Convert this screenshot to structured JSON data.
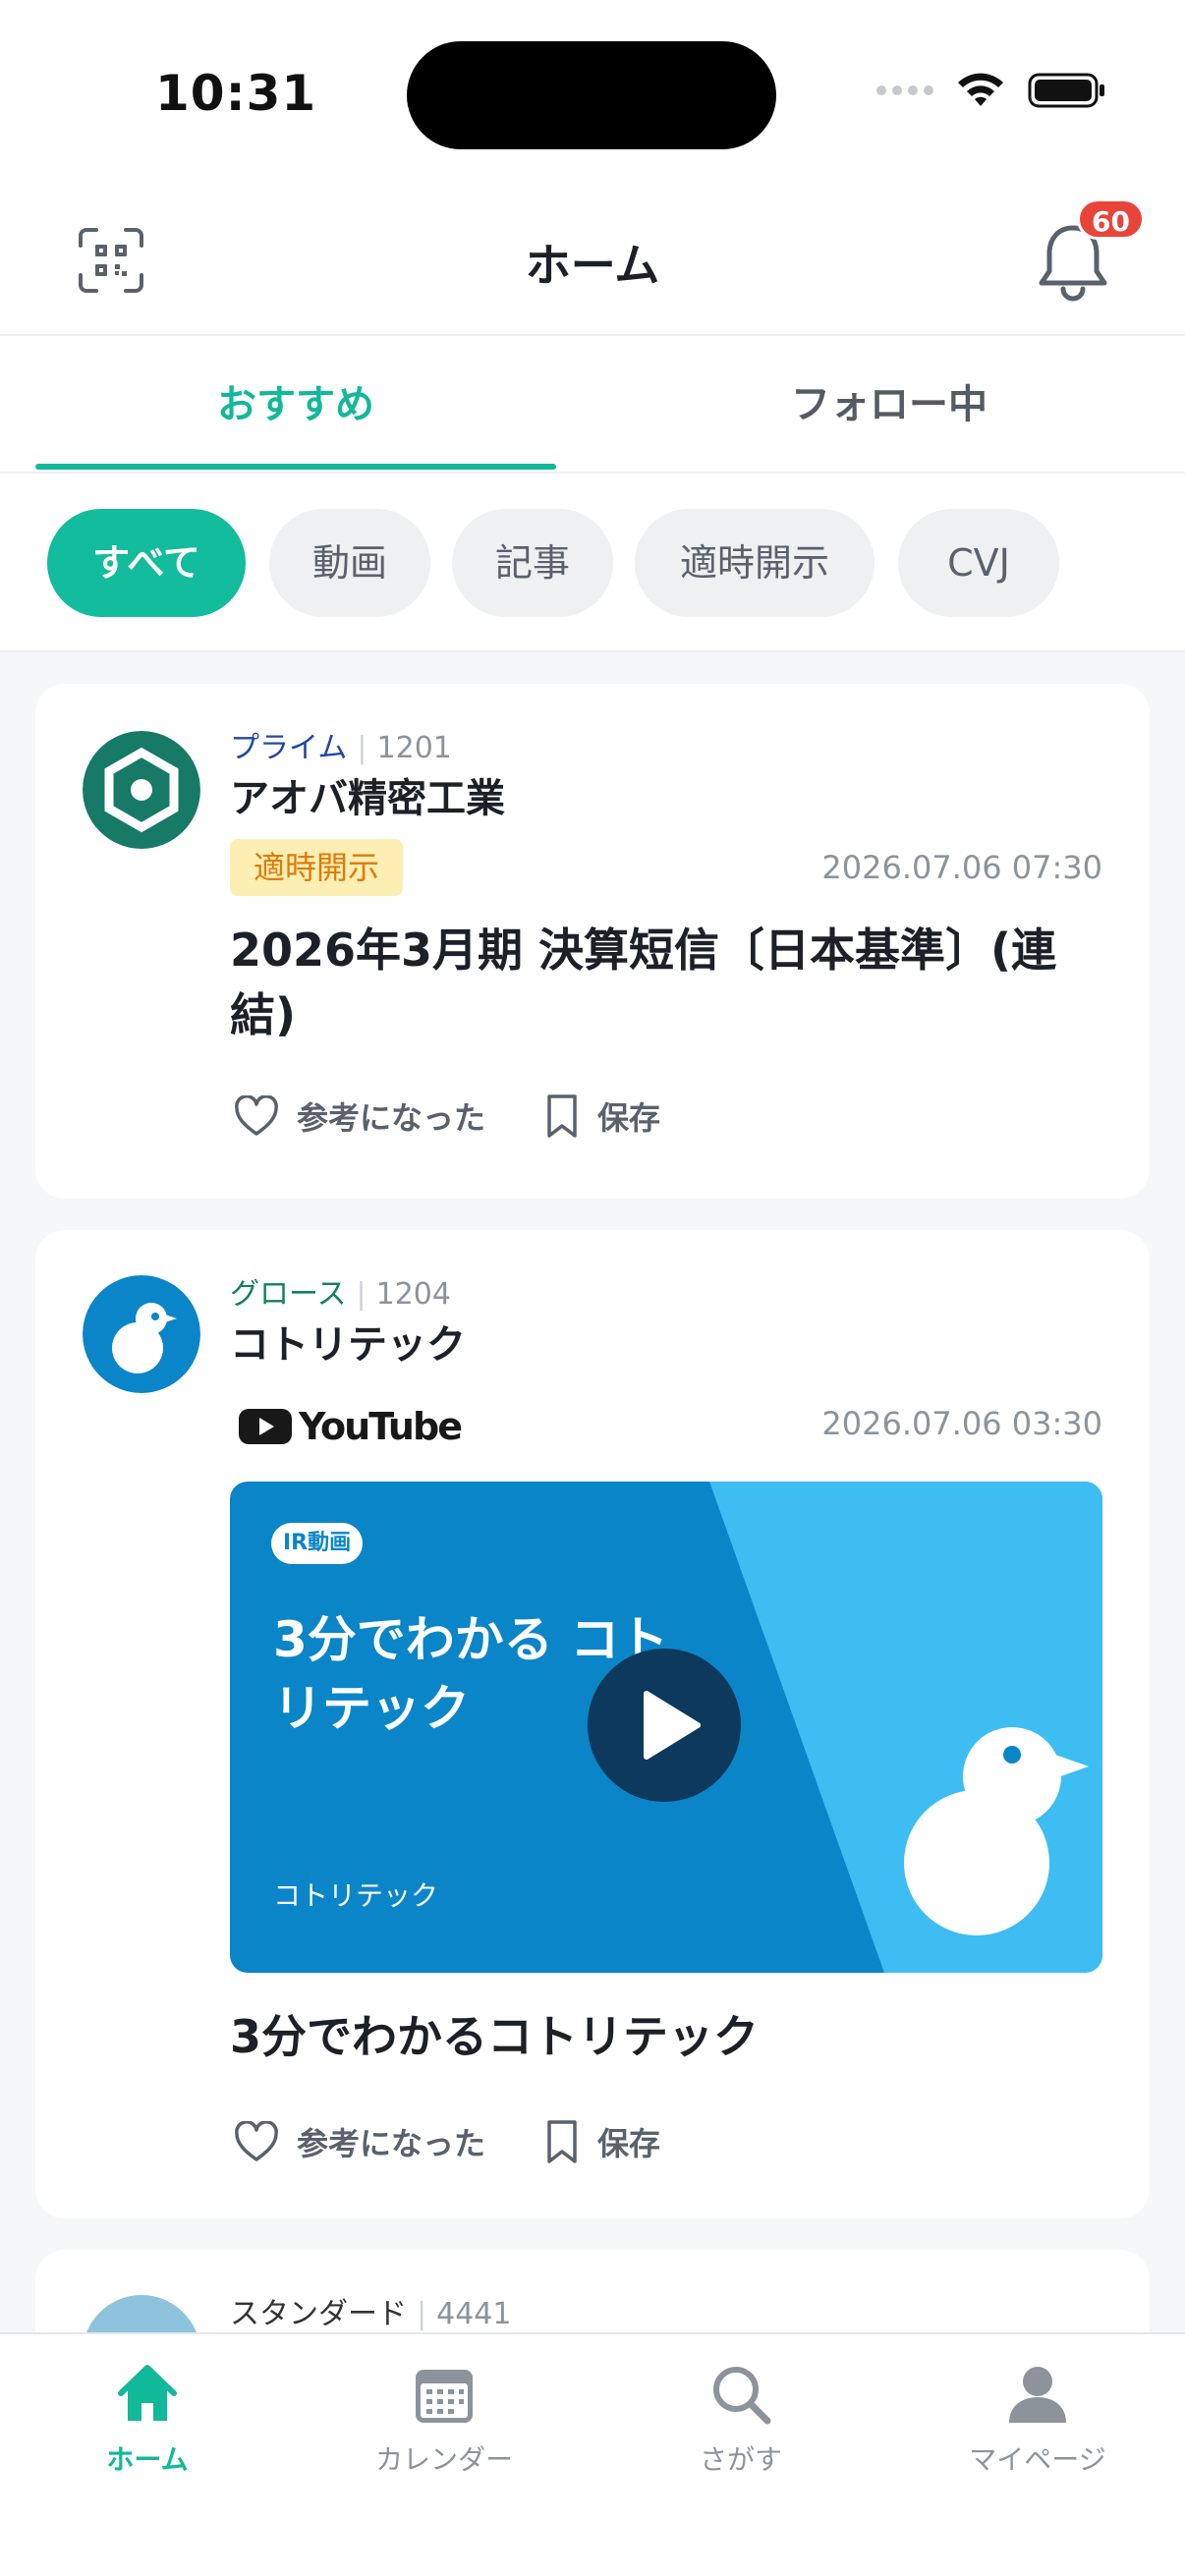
{
  "status_bar": {
    "time": "10:31"
  },
  "header": {
    "title": "ホーム",
    "notification_count": "60"
  },
  "tabs": [
    {
      "label": "おすすめ",
      "active": true
    },
    {
      "label": "フォロー中",
      "active": false
    }
  ],
  "filters": [
    {
      "label": "すべて",
      "active": true
    },
    {
      "label": "動画",
      "active": false
    },
    {
      "label": "記事",
      "active": false
    },
    {
      "label": "適時開示",
      "active": false
    },
    {
      "label": "CVJ",
      "active": false
    }
  ],
  "feed": [
    {
      "market": "プライム",
      "code": "1201",
      "company": "アオバ精密工業",
      "type_tag": "適時開示",
      "date": "2026.07.06 07:30",
      "title": "2026年3月期 決算短信〔日本基準〕(連結)",
      "like_label": "参考になった",
      "save_label": "保存"
    },
    {
      "market": "グロース",
      "code": "1204",
      "company": "コトリテック",
      "source": "YouTube",
      "date": "2026.07.06 03:30",
      "video": {
        "tag": "IR動画",
        "headline": "3分でわかる コトリテック",
        "brand": "コトリテック"
      },
      "title": "3分でわかるコトリテック",
      "like_label": "参考になった",
      "save_label": "保存"
    },
    {
      "market": "スタンダード",
      "code": "4441"
    }
  ],
  "bottom_nav": [
    {
      "label": "ホーム",
      "icon": "home-icon",
      "active": true
    },
    {
      "label": "カレンダー",
      "icon": "calendar-icon",
      "active": false
    },
    {
      "label": "さがす",
      "icon": "search-icon",
      "active": false
    },
    {
      "label": "マイページ",
      "icon": "person-icon",
      "active": false
    }
  ],
  "colors": {
    "accent": "#12b89a",
    "badge": "#e9443a",
    "disclosure_tag_bg": "#fdeeb4",
    "disclosure_tag_text": "#e07a06",
    "video_bg": "#0a85c8"
  }
}
